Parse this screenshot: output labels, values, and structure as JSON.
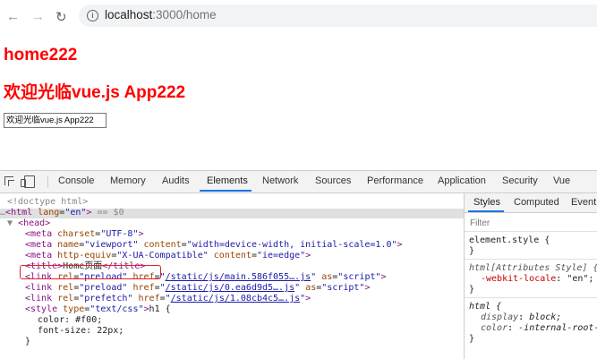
{
  "browser": {
    "back_icon": "←",
    "forward_icon": "→",
    "reload_icon": "↻",
    "info_icon": "i",
    "url_host": "localhost",
    "url_path": ":3000/home"
  },
  "page": {
    "heading1": "home222",
    "heading2": "欢迎光临vue.js App222",
    "input_value": "欢迎光临vue.js App222",
    "heading_color": "#ff0000"
  },
  "devtools": {
    "tabs": [
      "Console",
      "Memory",
      "Audits",
      "Elements",
      "Network",
      "Sources",
      "Performance",
      "Application",
      "Security",
      "Vue"
    ],
    "active_tab": "Elements",
    "styles_tabs": [
      "Styles",
      "Computed",
      "Event"
    ],
    "filter_placeholder": "Filter",
    "dom": {
      "doctype": "<!doctype html>",
      "html_line": {
        "prefix": "…",
        "tag": "html",
        "attr": "lang",
        "value": "en",
        "suffix": "== $0"
      },
      "head": "head",
      "meta_charset": {
        "attr": "charset",
        "value": "UTF-8"
      },
      "meta_viewport": {
        "attr1": "name",
        "val1": "viewport",
        "attr2": "content",
        "val2": "width=device-width, initial-scale=1.0"
      },
      "meta_compat": {
        "attr1": "http-equiv",
        "val1": "X-UA-Compatible",
        "attr2": "content",
        "val2": "ie=edge"
      },
      "title": "Home页面",
      "link1": {
        "rel": "preload",
        "href": "/static/js/main.586f055….js",
        "as": "script"
      },
      "link2": {
        "rel": "preload",
        "href": "/static/js/0.ea6d9d5….js",
        "as": "script"
      },
      "link3": {
        "rel": "prefetch",
        "href": "/static/js/1.08cb4c5….js"
      },
      "style_open": {
        "attr": "type",
        "value": "text/css",
        "after": "h1 {"
      },
      "css_color": "color: #f00;",
      "css_font": "font-size: 22px;",
      "css_close": "}"
    },
    "styles": {
      "element_style": "element.style {",
      "close": "}",
      "html_attr_style": "html[Attributes Style] {",
      "webkit_locale_prop": "-webkit-locale",
      "webkit_locale_val": "\"en\";",
      "html_rule": "html {",
      "display_prop": "display",
      "display_val": "block;",
      "color_prop": "color",
      "color_val": "-internal-root-color;"
    }
  }
}
